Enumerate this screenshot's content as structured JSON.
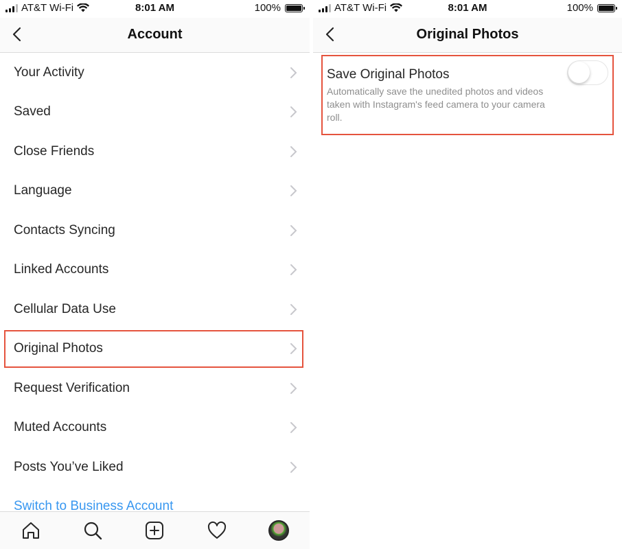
{
  "left": {
    "status": {
      "carrier": "AT&T Wi-Fi",
      "time": "8:01 AM",
      "battery": "100%"
    },
    "nav": {
      "title": "Account",
      "back_icon": "chevron-left-icon"
    },
    "items": [
      {
        "label": "Your Activity"
      },
      {
        "label": "Saved"
      },
      {
        "label": "Close Friends"
      },
      {
        "label": "Language"
      },
      {
        "label": "Contacts Syncing"
      },
      {
        "label": "Linked Accounts"
      },
      {
        "label": "Cellular Data Use"
      },
      {
        "label": "Original Photos"
      },
      {
        "label": "Request Verification"
      },
      {
        "label": "Muted Accounts"
      },
      {
        "label": "Posts You’ve Liked"
      }
    ],
    "switch_link": "Switch to Business Account",
    "tabs": [
      "home-icon",
      "search-icon",
      "new-post-icon",
      "activity-heart-icon",
      "profile-avatar"
    ]
  },
  "right": {
    "status": {
      "carrier": "AT&T Wi-Fi",
      "time": "8:01 AM",
      "battery": "100%"
    },
    "nav": {
      "title": "Original Photos",
      "back_icon": "chevron-left-icon"
    },
    "setting": {
      "label": "Save Original Photos",
      "description": "Automatically save the unedited photos and videos taken with Instagram's feed camera to your camera roll.",
      "toggle_on": false
    }
  },
  "colors": {
    "highlight": "#e5533d",
    "link": "#3897f0",
    "secondary_text": "#8e8e8e"
  }
}
